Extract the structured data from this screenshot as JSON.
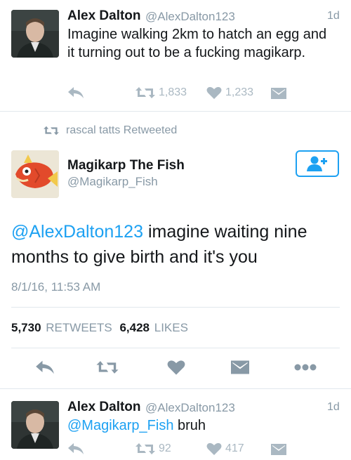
{
  "tweet1": {
    "name": "Alex Dalton",
    "handle": "@AlexDalton123",
    "time": "1d",
    "text": "Imagine walking 2km to hatch an egg and it turning out to be a fucking magikarp.",
    "retweets": "1,833",
    "likes": "1,233"
  },
  "retweet_banner": {
    "label": "rascal tatts Retweeted"
  },
  "main_tweet": {
    "name": "Magikarp The Fish",
    "handle": "@Magikarp_Fish",
    "mention": "@AlexDalton123",
    "text": " imagine waiting nine months to give birth and it's you",
    "timestamp": "8/1/16, 11:53 AM",
    "retweet_count": "5,730",
    "retweet_label": "RETWEETS",
    "like_count": "6,428",
    "like_label": "LIKES"
  },
  "reply": {
    "name": "Alex Dalton",
    "handle": "@AlexDalton123",
    "time": "1d",
    "mention": "@Magikarp_Fish",
    "text": " bruh",
    "retweets": "92",
    "likes": "417"
  },
  "colors": {
    "accent": "#1da1f2",
    "muted": "#8899a6",
    "icon": "#aab8c2"
  }
}
